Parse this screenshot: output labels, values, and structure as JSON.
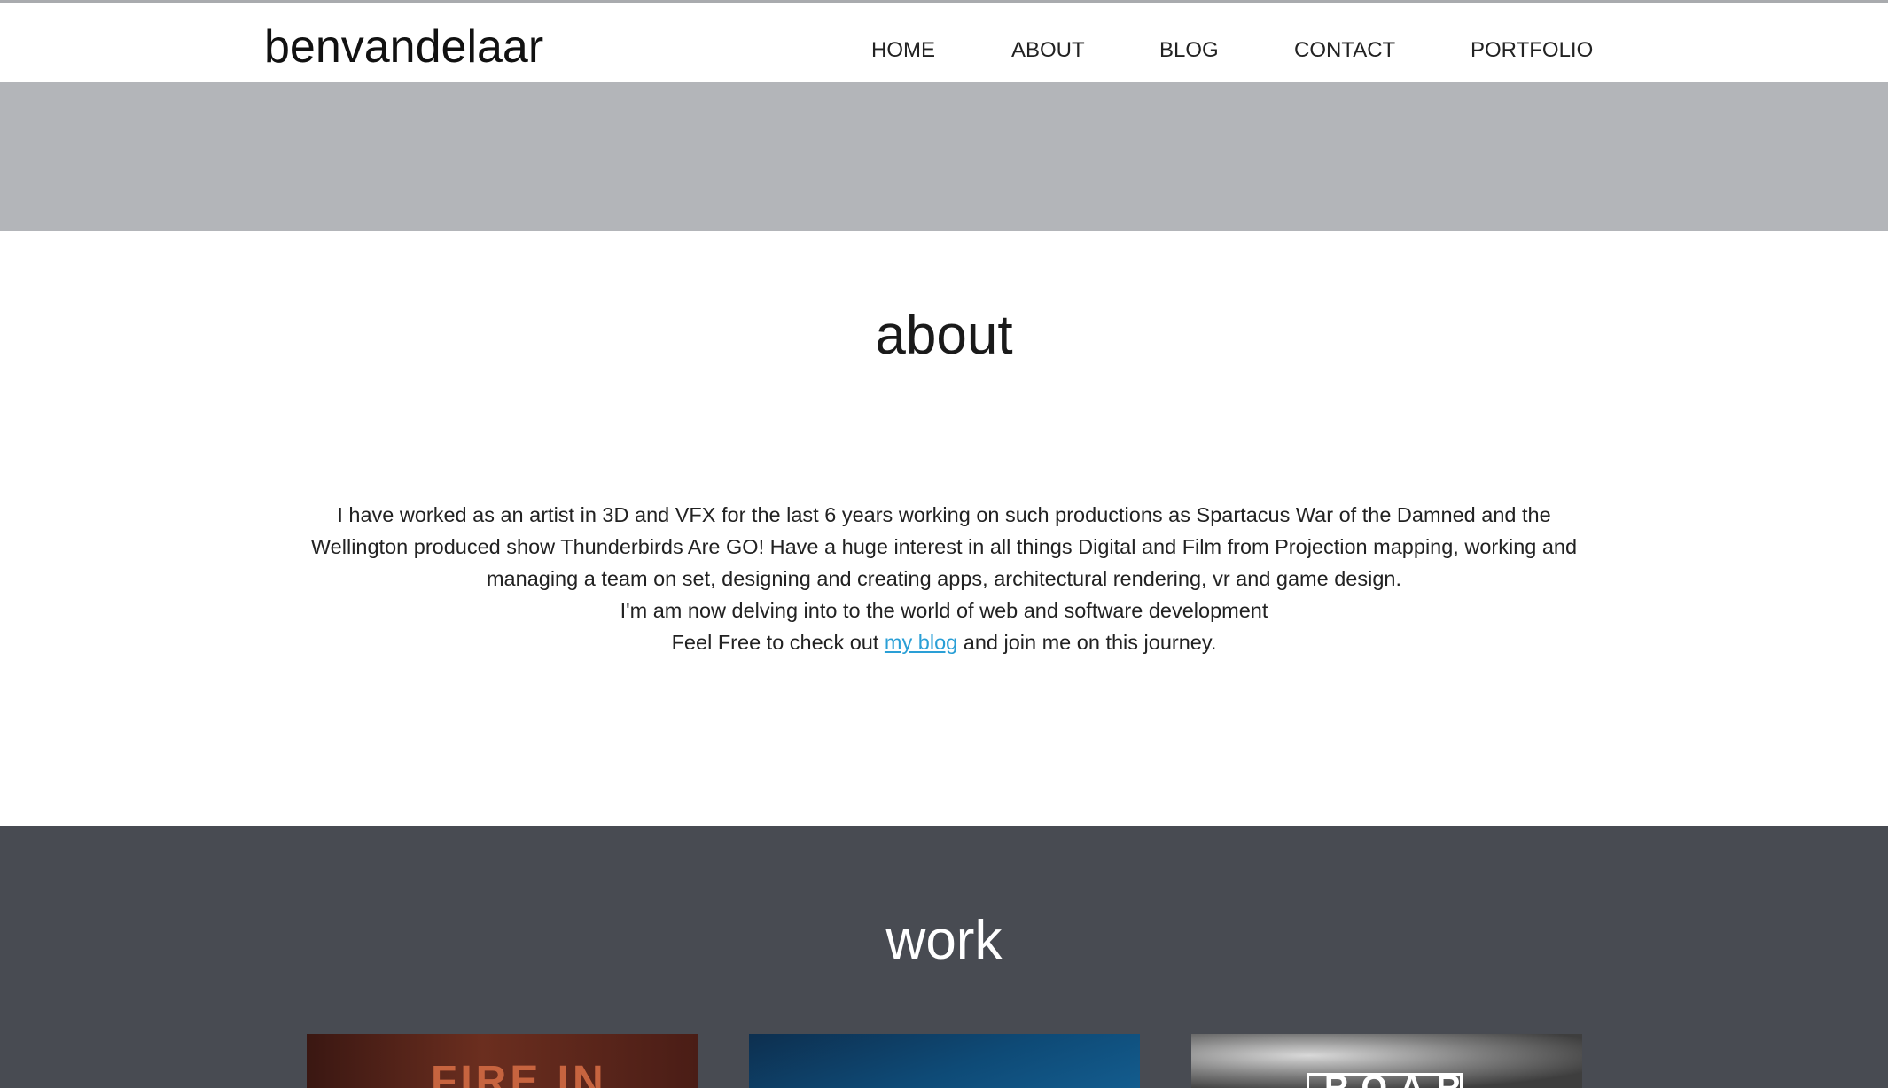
{
  "header": {
    "brand": "benvandelaar",
    "nav": [
      {
        "label": "HOME"
      },
      {
        "label": "ABOUT"
      },
      {
        "label": "BLOG"
      },
      {
        "label": "CONTACT"
      },
      {
        "label": "PORTFOLIO"
      }
    ]
  },
  "about": {
    "title": "about",
    "paragraph_1": "I have worked as an artist in 3D and VFX for the last 6 years working on such productions as Spartacus War of the Damned and the Wellington produced show Thunderbirds Are GO! Have a huge interest in all things Digital and Film from Projection mapping, working and managing a team on set, designing and creating apps, architectural rendering, vr and game design.",
    "paragraph_2": "I'm am now delving into to the world of web and software development",
    "paragraph_3_before": "Feel Free to check out ",
    "paragraph_3_link": "my blog",
    "paragraph_3_after": " and join me on this journey."
  },
  "work": {
    "title": "work",
    "items": [
      {
        "label": "FIRE IN"
      },
      {
        "label": ""
      },
      {
        "label": "ROAR"
      }
    ]
  },
  "colors": {
    "hero": "#b3b5b9",
    "work_bg": "#484b52",
    "link": "#2a9fd6"
  }
}
